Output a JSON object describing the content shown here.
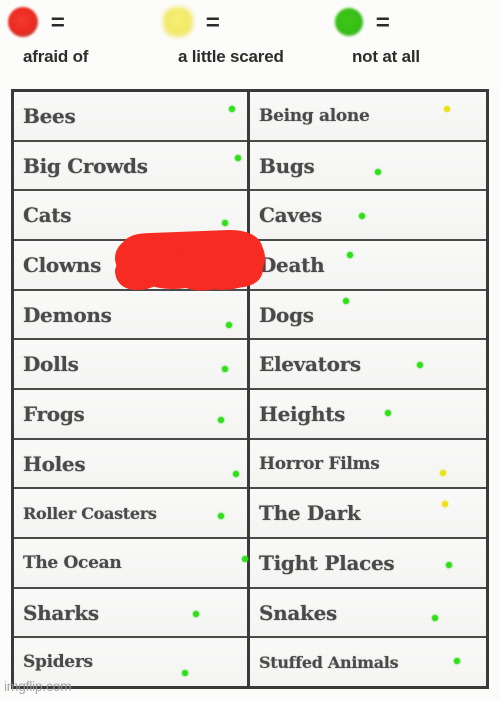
{
  "legend": {
    "items": [
      {
        "icon": "red-circle-icon",
        "color": "#ec2a1f",
        "equals": "=",
        "label": "afraid of",
        "key": "red"
      },
      {
        "icon": "yellow-circle-icon",
        "color": "#f2ea63",
        "equals": "=",
        "label": "a little scared",
        "key": "yellow"
      },
      {
        "icon": "green-circle-icon",
        "color": "#35bd13",
        "equals": "=",
        "label": "not at all",
        "key": "green"
      }
    ]
  },
  "table": {
    "left_column": [
      {
        "label": "Bees",
        "mark": "green"
      },
      {
        "label": "Big Crowds",
        "mark": "green"
      },
      {
        "label": "Cats",
        "mark": "green"
      },
      {
        "label": "Clowns",
        "mark": "hidden"
      },
      {
        "label": "Demons",
        "mark": "green"
      },
      {
        "label": "Dolls",
        "mark": "green"
      },
      {
        "label": "Frogs",
        "mark": "green"
      },
      {
        "label": "Holes",
        "mark": "green"
      },
      {
        "label": "Roller Coasters",
        "mark": "green"
      },
      {
        "label": "The Ocean",
        "mark": "green"
      },
      {
        "label": "Sharks",
        "mark": "green"
      },
      {
        "label": "Spiders",
        "mark": "green"
      }
    ],
    "right_column": [
      {
        "label": "Being alone",
        "mark": "yellow"
      },
      {
        "label": "Bugs",
        "mark": "green"
      },
      {
        "label": "Caves",
        "mark": "green"
      },
      {
        "label": "Death",
        "mark": "green"
      },
      {
        "label": "Dogs",
        "mark": "green"
      },
      {
        "label": "Elevators",
        "mark": "green"
      },
      {
        "label": "Heights",
        "mark": "green"
      },
      {
        "label": "Horror Films",
        "mark": "yellow"
      },
      {
        "label": "The Dark",
        "mark": "yellow"
      },
      {
        "label": "Tight Places",
        "mark": "green"
      },
      {
        "label": "Snakes",
        "mark": "green"
      },
      {
        "label": "Stuffed Animals",
        "mark": "green"
      }
    ]
  },
  "redaction": {
    "name": "red-scribble-over-clowns-answer",
    "color": "#f72b21"
  },
  "watermark": {
    "text": "imgflip.com"
  }
}
